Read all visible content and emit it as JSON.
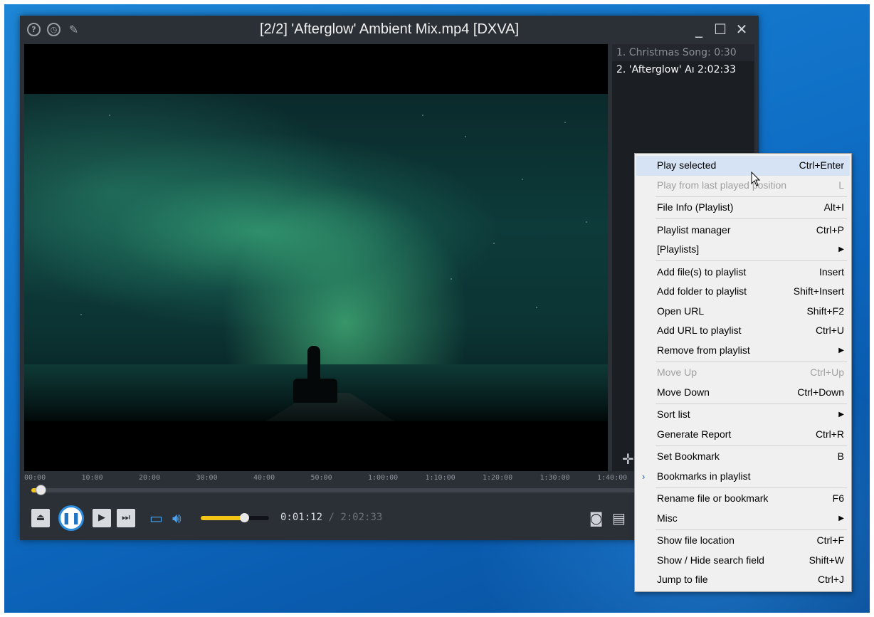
{
  "window": {
    "title": "[2/2] 'Afterglow' Ambient Mix.mp4 [DXVA]",
    "titlebar_icons": [
      "help-icon",
      "history-icon",
      "pin-icon"
    ],
    "controls": [
      "minimize",
      "maximize",
      "close"
    ]
  },
  "playlist": {
    "items": [
      {
        "label": "1. Christmas Song: 0:30",
        "active": false
      },
      {
        "label": "2. 'Afterglow' Aı 2:02:33",
        "active": true
      }
    ]
  },
  "timeline": {
    "ticks": [
      "00:00",
      "10:00",
      "20:00",
      "30:00",
      "40:00",
      "50:00",
      "1:00:00",
      "1:10:00",
      "1:20:00",
      "1:30:00",
      "1:40:00"
    ],
    "progress_fraction": 0.0098
  },
  "controls": {
    "current_time": "0:01:12",
    "separator": "/",
    "total_time": "2:02:33",
    "volume_fraction": 0.64,
    "accent_color": "#f5c518"
  },
  "context_menu": {
    "items": [
      {
        "label": "Play selected",
        "shortcut": "Ctrl+Enter",
        "state": "highlight"
      },
      {
        "label": "Play from last played position",
        "shortcut": "L",
        "state": "disabled"
      },
      {
        "separator": true
      },
      {
        "label": "File Info (Playlist)",
        "shortcut": "Alt+I"
      },
      {
        "separator": true
      },
      {
        "label": "Playlist manager",
        "shortcut": "Ctrl+P"
      },
      {
        "label": "[Playlists]",
        "submenu": true
      },
      {
        "separator": true
      },
      {
        "label": "Add file(s) to playlist",
        "shortcut": "Insert"
      },
      {
        "label": "Add folder to playlist",
        "shortcut": "Shift+Insert"
      },
      {
        "label": "Open URL",
        "shortcut": "Shift+F2"
      },
      {
        "label": "Add URL to playlist",
        "shortcut": "Ctrl+U"
      },
      {
        "label": "Remove from playlist",
        "submenu": true
      },
      {
        "separator": true
      },
      {
        "label": "Move Up",
        "shortcut": "Ctrl+Up",
        "state": "disabled"
      },
      {
        "label": "Move Down",
        "shortcut": "Ctrl+Down"
      },
      {
        "separator": true
      },
      {
        "label": "Sort list",
        "submenu": true
      },
      {
        "label": "Generate Report",
        "shortcut": "Ctrl+R"
      },
      {
        "separator": true
      },
      {
        "label": "Set Bookmark",
        "shortcut": "B"
      },
      {
        "label": "Bookmarks in playlist",
        "checked": true
      },
      {
        "separator": true
      },
      {
        "label": "Rename file or bookmark",
        "shortcut": "F6"
      },
      {
        "label": "Misc",
        "submenu": true
      },
      {
        "separator": true
      },
      {
        "label": "Show file location",
        "shortcut": "Ctrl+F"
      },
      {
        "label": "Show / Hide search field",
        "shortcut": "Shift+W"
      },
      {
        "label": "Jump to file",
        "shortcut": "Ctrl+J"
      }
    ]
  }
}
